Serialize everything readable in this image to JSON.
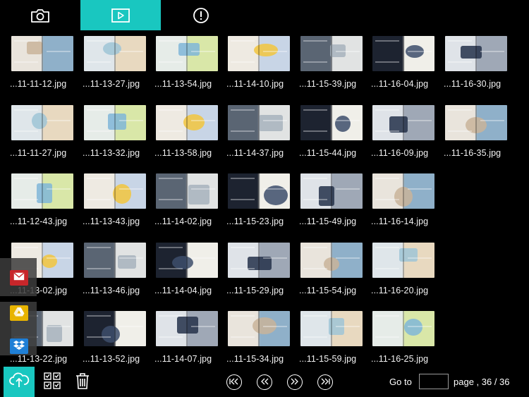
{
  "toolbar": {
    "tabs": [
      {
        "name": "camera",
        "icon": "camera-icon"
      },
      {
        "name": "slideshow",
        "icon": "play-icon",
        "active": true
      },
      {
        "name": "info",
        "icon": "info-icon"
      }
    ],
    "accent": "#19c7c0"
  },
  "photos": [
    [
      "...11-11-12.jpg",
      "...11-13-27.jpg",
      "...11-13-54.jpg",
      "...11-14-10.jpg",
      "...11-15-39.jpg",
      "...11-16-04.jpg",
      "...11-16-30.jpg"
    ],
    [
      "...11-11-27.jpg",
      "...11-13-32.jpg",
      "...11-13-58.jpg",
      "...11-14-37.jpg",
      "...11-15-44.jpg",
      "...11-16-09.jpg",
      "...11-16-35.jpg"
    ],
    [
      "...11-12-43.jpg",
      "...11-13-43.jpg",
      "...11-14-02.jpg",
      "...11-15-23.jpg",
      "...11-15-49.jpg",
      "...11-16-14.jpg"
    ],
    [
      "...11-13-02.jpg",
      "...11-13-46.jpg",
      "...11-14-04.jpg",
      "...11-15-29.jpg",
      "...11-15-54.jpg",
      "...11-16-20.jpg"
    ],
    [
      "...11-13-22.jpg",
      "...11-13-52.jpg",
      "...11-14-07.jpg",
      "...11-15-34.jpg",
      "...11-15-59.jpg",
      "...11-16-25.jpg"
    ]
  ],
  "share": [
    {
      "name": "mail",
      "icon": "mail-icon",
      "color": "#c8262a"
    },
    {
      "name": "google-drive",
      "icon": "google-drive-icon",
      "color": "#e8b400"
    },
    {
      "name": "dropbox",
      "icon": "dropbox-icon",
      "color": "#1f7fd6"
    }
  ],
  "bottom": {
    "upload_icon": "cloud-upload-icon",
    "select_icon": "select-all-icon",
    "delete_icon": "trash-icon",
    "nav_icons": [
      "first-page-icon",
      "previous-page-icon",
      "next-page-icon",
      "last-page-icon"
    ],
    "goto_label": "Go to",
    "goto_value": "",
    "page_text": "page , 36 / 36"
  }
}
